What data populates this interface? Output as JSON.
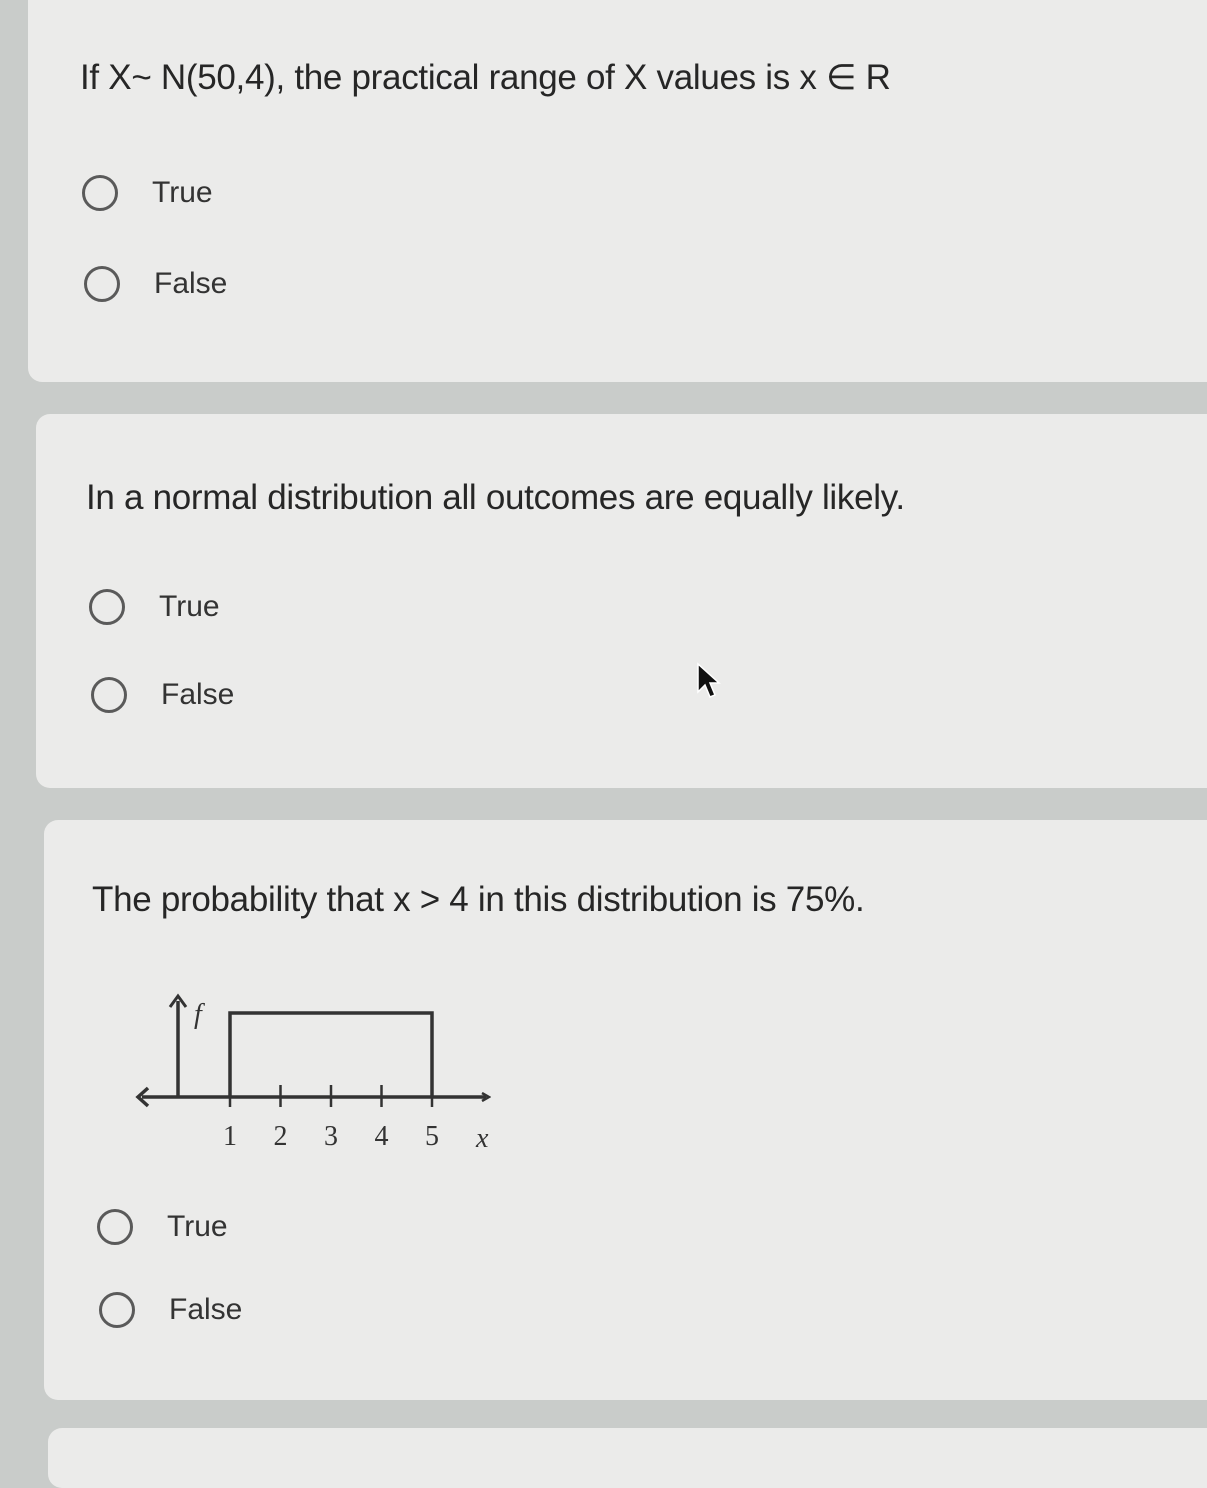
{
  "questions": [
    {
      "text": "If X~ N(50,4), the practical range of X values is x ∈ R",
      "options": [
        "True",
        "False"
      ]
    },
    {
      "text": "In a normal distribution all outcomes are equally likely.",
      "options": [
        "True",
        "False"
      ]
    },
    {
      "text": "The probability that x > 4 in this distribution is 75%.",
      "options": [
        "True",
        "False"
      ]
    }
  ],
  "chart_data": {
    "type": "line",
    "x_ticks": [
      1,
      2,
      3,
      4,
      5
    ],
    "xlabel": "x",
    "ylabel": "f",
    "series": [
      {
        "x": [
          1,
          1,
          5,
          5
        ],
        "y": [
          0,
          1,
          1,
          0
        ]
      }
    ],
    "xlim": [
      0,
      6
    ]
  },
  "colors": {
    "page_background": "#c9ccca",
    "card_background": "#ebebea",
    "radio_border": "#5a5a5a",
    "text": "#262626"
  },
  "icons": {
    "radio": "empty-circle",
    "cursor": "arrow-cursor"
  }
}
